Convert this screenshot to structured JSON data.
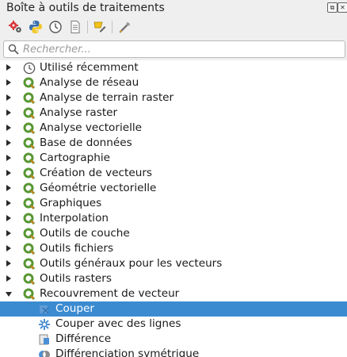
{
  "panel": {
    "title": "Boîte à outils de traitements",
    "float_button": "⧉",
    "close_button": "✕"
  },
  "toolbar": [
    {
      "name": "models-icon"
    },
    {
      "name": "python-icon"
    },
    {
      "name": "history-icon"
    },
    {
      "name": "results-icon"
    },
    {
      "name": "edit-features-icon"
    },
    {
      "name": "options-icon"
    }
  ],
  "search": {
    "placeholder": "Rechercher..."
  },
  "tree": {
    "groups": [
      {
        "label": "Utilisé récemment",
        "icon": "clock-icon",
        "expanded": false
      },
      {
        "label": "Analyse de réseau",
        "icon": "qgis-icon",
        "expanded": false
      },
      {
        "label": "Analyse de terrain raster",
        "icon": "qgis-icon",
        "expanded": false
      },
      {
        "label": "Analyse raster",
        "icon": "qgis-icon",
        "expanded": false
      },
      {
        "label": "Analyse vectorielle",
        "icon": "qgis-icon",
        "expanded": false
      },
      {
        "label": "Base de données",
        "icon": "qgis-icon",
        "expanded": false
      },
      {
        "label": "Cartographie",
        "icon": "qgis-icon",
        "expanded": false
      },
      {
        "label": "Création de vecteurs",
        "icon": "qgis-icon",
        "expanded": false
      },
      {
        "label": "Géométrie vectorielle",
        "icon": "qgis-icon",
        "expanded": false
      },
      {
        "label": "Graphiques",
        "icon": "qgis-icon",
        "expanded": false
      },
      {
        "label": "Interpolation",
        "icon": "qgis-icon",
        "expanded": false
      },
      {
        "label": "Outils de couche",
        "icon": "qgis-icon",
        "expanded": false
      },
      {
        "label": "Outils fichiers",
        "icon": "qgis-icon",
        "expanded": false
      },
      {
        "label": "Outils généraux pour les vecteurs",
        "icon": "qgis-icon",
        "expanded": false
      },
      {
        "label": "Outils rasters",
        "icon": "qgis-icon",
        "expanded": false
      },
      {
        "label": "Recouvrement de vecteur",
        "icon": "qgis-icon",
        "expanded": true
      }
    ],
    "children": [
      {
        "label": "Couper",
        "icon": "clip-icon",
        "selected": true
      },
      {
        "label": "Couper avec des lignes",
        "icon": "split-lines-icon",
        "selected": false
      },
      {
        "label": "Différence",
        "icon": "difference-icon",
        "selected": false
      },
      {
        "label": "Différenciation symétrique",
        "icon": "sym-difference-icon",
        "selected": false
      }
    ]
  },
  "colors": {
    "selection": "#3b8bd1",
    "qgis_green": "#589632",
    "qgis_yellow": "#ee7913"
  }
}
